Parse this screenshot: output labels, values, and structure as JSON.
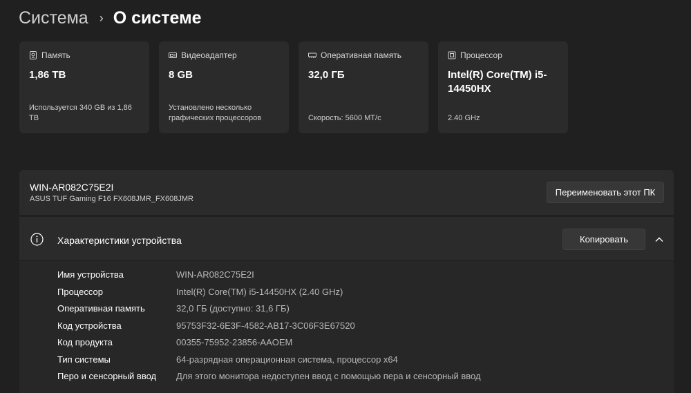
{
  "breadcrumb": {
    "parent": "Система",
    "separator": "›",
    "current": "О системе"
  },
  "cards": [
    {
      "icon": "storage-icon",
      "title": "Память",
      "value": "1,86 ТB",
      "note": "Используется 340 GB из 1,86 ТB"
    },
    {
      "icon": "gpu-icon",
      "title": "Видеоадаптер",
      "value": "8 GB",
      "note": "Установлено несколько графических процессоров"
    },
    {
      "icon": "ram-icon",
      "title": "Оперативная память",
      "value": "32,0 ГБ",
      "note": "Скорость: 5600 МТ/с"
    },
    {
      "icon": "cpu-icon",
      "title": "Процессор",
      "value": "Intel(R) Core(TM) i5-14450HX",
      "note": "2.40 GHz"
    }
  ],
  "device": {
    "name": "WIN-AR082C75E2I",
    "model": "ASUS TUF Gaming F16 FX608JMR_FX608JMR",
    "rename_label": "Переименовать этот ПК"
  },
  "specs": {
    "title": "Характеристики устройства",
    "copy_label": "Копировать",
    "rows": [
      {
        "label": "Имя устройства",
        "value": "WIN-AR082C75E2I"
      },
      {
        "label": "Процессор",
        "value": "Intel(R) Core(TM) i5-14450HX (2.40 GHz)"
      },
      {
        "label": "Оперативная память",
        "value": "32,0 ГБ (доступно: 31,6 ГБ)"
      },
      {
        "label": "Код устройства",
        "value": "95753F32-6E3F-4582-AB17-3C06F3E67520"
      },
      {
        "label": "Код продукта",
        "value": "00355-75952-23856-AAOEM"
      },
      {
        "label": "Тип системы",
        "value": "64-разрядная операционная система, процессор x64"
      },
      {
        "label": "Перо и сенсорный ввод",
        "value": "Для этого монитора недоступен ввод с помощью пера и сенсорный ввод"
      }
    ]
  },
  "colors": {
    "background": "#202020",
    "card": "#2b2b2b",
    "button": "#373737"
  }
}
